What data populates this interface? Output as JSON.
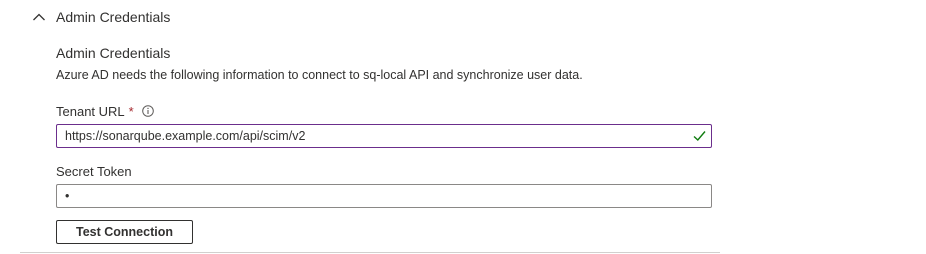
{
  "section": {
    "title": "Admin Credentials",
    "expanded": true
  },
  "content": {
    "heading": "Admin Credentials",
    "description": "Azure AD needs the following information to connect to sq-local API and synchronize user data."
  },
  "tenant_url": {
    "label": "Tenant URL",
    "required_marker": "*",
    "value": "https://sonarqube.example.com/api/scim/v2",
    "valid": true
  },
  "secret_token": {
    "label": "Secret Token",
    "value": "•"
  },
  "test_button": {
    "label": "Test Connection"
  },
  "colors": {
    "focus_border": "#6b2e8c",
    "valid_check": "#107c10",
    "required": "#a4262c",
    "text": "#323130"
  }
}
